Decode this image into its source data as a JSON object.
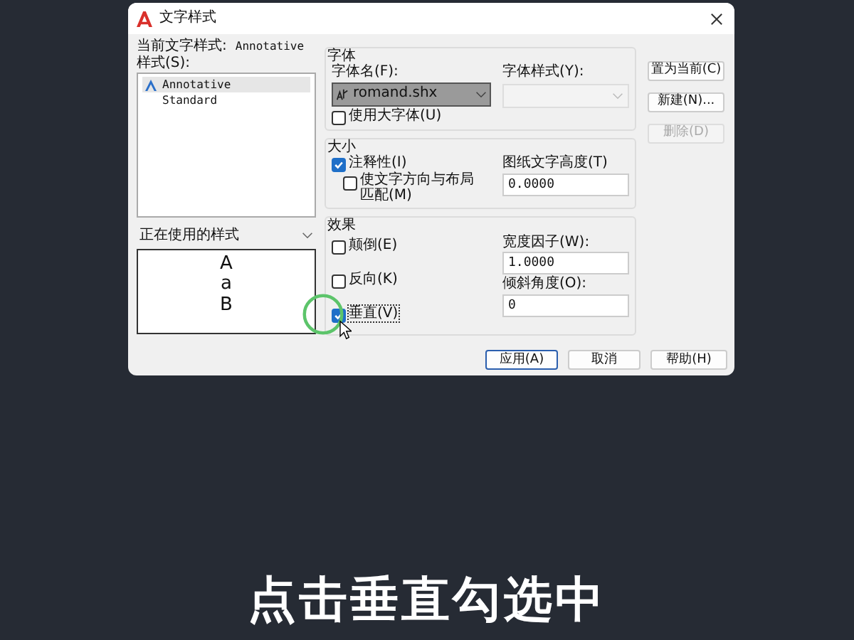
{
  "window": {
    "title": "文字样式"
  },
  "current_style": {
    "label": "当前文字样式:",
    "value": "Annotative"
  },
  "styles": {
    "label": "样式(S):",
    "items": [
      {
        "name": "Annotative",
        "annotative": true,
        "selected": true
      },
      {
        "name": "Standard",
        "annotative": false,
        "selected": false
      }
    ]
  },
  "filter": {
    "value": "正在使用的样式"
  },
  "preview_text": "AaB",
  "font": {
    "heading": "字体",
    "name_label": "字体名(F):",
    "name_value": "romand.shx",
    "style_label": "字体样式(Y):",
    "style_disabled": true,
    "big_font": {
      "label": "使用大字体(U)",
      "checked": false
    }
  },
  "size": {
    "heading": "大小",
    "annotative": {
      "label": "注释性(I)",
      "checked": true
    },
    "match_orientation": {
      "label": "使文字方向与布局匹配(M)",
      "checked": false
    },
    "height_label": "图纸文字高度(T)",
    "height_value": "0.0000"
  },
  "effects": {
    "heading": "效果",
    "checks": [
      {
        "label": "颠倒(E)",
        "checked": false
      },
      {
        "label": "反向(K)",
        "checked": false
      },
      {
        "label": "垂直(V)",
        "checked": true
      }
    ],
    "width_label": "宽度因子(W):",
    "width_value": "1.0000",
    "oblique_label": "倾斜角度(O):",
    "oblique_value": "0"
  },
  "side_buttons": [
    {
      "label": "置为当前(C)",
      "disabled": false
    },
    {
      "label": "新建(N)...",
      "disabled": false
    },
    {
      "label": "删除(D)",
      "disabled": true
    }
  ],
  "bottom_buttons": [
    {
      "label": "应用(A)",
      "default": true
    },
    {
      "label": "取消",
      "default": false
    },
    {
      "label": "帮助(H)",
      "default": false
    }
  ],
  "caption": "点击垂直勾选中"
}
